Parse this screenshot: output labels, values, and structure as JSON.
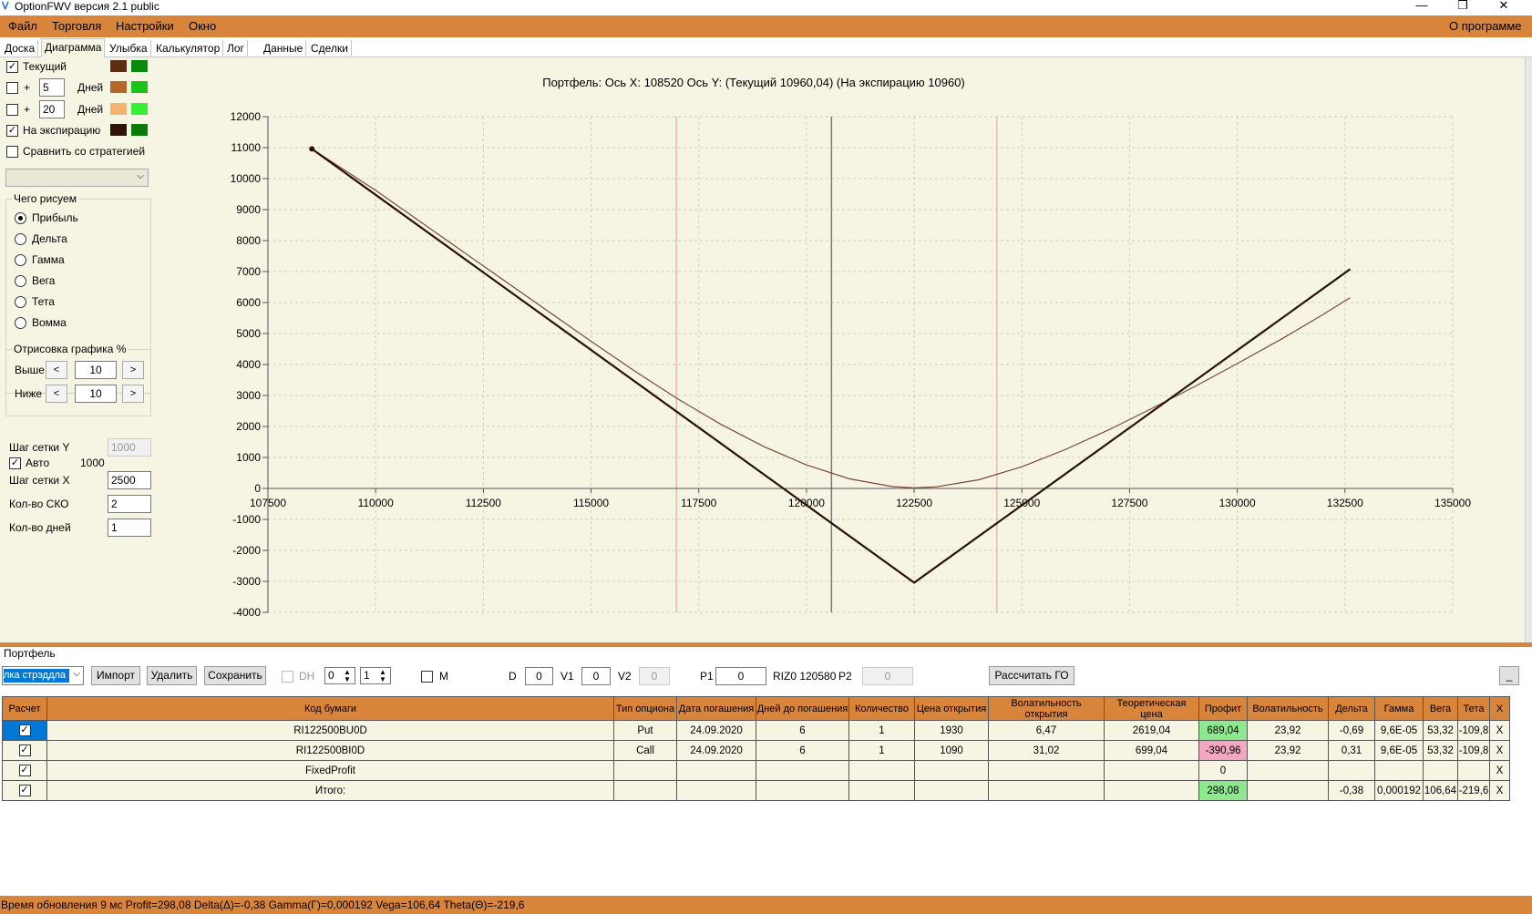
{
  "window": {
    "title": "OptionFWV версия 2.1 public"
  },
  "menu": {
    "file": "Файл",
    "trade": "Торговля",
    "settings": "Настройки",
    "window": "Окно",
    "about": "О программе"
  },
  "tabs": [
    "Доска",
    "Диаграмма",
    "Улыбка",
    "Калькулятор",
    "Лог",
    "Данные",
    "Сделки"
  ],
  "left": {
    "current": "Текущий",
    "plus": "+",
    "days": "Дней",
    "days1": "5",
    "days2": "20",
    "expiry": "На экспирацию",
    "compare": "Сравнить со стратегией",
    "what_draw": "Чего рисуем",
    "radios": [
      "Прибыль",
      "Дельта",
      "Гамма",
      "Вега",
      "Тета",
      "Вомма"
    ],
    "draw_pct": "Отрисовка графика %",
    "above": "Выше",
    "below": "Ниже",
    "above_val": "10",
    "below_val": "10",
    "lt": "<",
    "gt": ">",
    "grid_y": "Шаг сетки Y",
    "grid_y_val": "1000",
    "auto": "Авто",
    "auto_val": "1000",
    "grid_x": "Шаг сетки X",
    "grid_x_val": "2500",
    "sko": "Кол-во СКО",
    "sko_val": "2",
    "ndays": "Кол-во дней",
    "ndays_val": "1"
  },
  "colors": {
    "current_a": "#5c2e12",
    "current_b": "#0a8a0a",
    "d5_a": "#b8652a",
    "d5_b": "#18c418",
    "d20_a": "#f5b370",
    "d20_b": "#36f036",
    "exp_a": "#2e1606",
    "exp_b": "#0a7a0a",
    "curve_current": "#7a4a36",
    "curve_expiry": "#2a1208",
    "vline": "#7a7a7a",
    "vline_sd": "#e89a9a"
  },
  "chart_data": {
    "type": "line",
    "title": "Портфель: Ось X: 108520 Ось Y:  (Текущий 10960,04)  (На экспирацию 10960)",
    "xlim": [
      107500,
      135000
    ],
    "ylim": [
      -4000,
      12000
    ],
    "x_ticks": [
      107500,
      110000,
      112500,
      115000,
      117500,
      120000,
      122500,
      125000,
      127500,
      130000,
      132500,
      135000
    ],
    "y_ticks": [
      12000,
      11000,
      10000,
      9000,
      8000,
      7000,
      6000,
      5000,
      4000,
      3000,
      2000,
      1000,
      0,
      -1000,
      -2000,
      -3000,
      -4000
    ],
    "current_price": 120580,
    "sd_lines": [
      116980,
      124420
    ],
    "marker": [
      108520,
      10960
    ],
    "series": [
      {
        "key": "current",
        "points": [
          [
            108520,
            10960
          ],
          [
            110000,
            9620
          ],
          [
            112500,
            7180
          ],
          [
            115000,
            4750
          ],
          [
            116000,
            3800
          ],
          [
            117000,
            2900
          ],
          [
            118000,
            2080
          ],
          [
            119000,
            1360
          ],
          [
            120000,
            760
          ],
          [
            121000,
            310
          ],
          [
            122000,
            60
          ],
          [
            122500,
            20
          ],
          [
            123000,
            50
          ],
          [
            124000,
            280
          ],
          [
            125000,
            700
          ],
          [
            126000,
            1250
          ],
          [
            127000,
            1880
          ],
          [
            128000,
            2570
          ],
          [
            129000,
            3280
          ],
          [
            130000,
            4030
          ],
          [
            131000,
            4800
          ],
          [
            132000,
            5620
          ],
          [
            132620,
            6160
          ]
        ]
      },
      {
        "key": "expiry",
        "points": [
          [
            108520,
            10960
          ],
          [
            122500,
            -3040
          ],
          [
            132620,
            7080
          ]
        ]
      }
    ]
  },
  "portfolio": {
    "caption": "Портфель",
    "strategy": "лка стрэддла",
    "import": "Импорт",
    "delete": "Удалить",
    "save": "Сохранить",
    "dh": "DH",
    "spin1": "0",
    "spin2": "1",
    "m": "M",
    "d_label": "D",
    "d_val": "0",
    "v1_label": "V1",
    "v1_val": "0",
    "v2_label": "V2",
    "v2_val": "0",
    "p1_label": "P1",
    "p1_val": "0",
    "riz": "RIZ0 120580",
    "p2_label": "P2",
    "p2_val": "0",
    "calc_go": "Рассчитать ГО",
    "minimize": "_"
  },
  "table": {
    "headers": [
      "Расчет",
      "Код бумаги",
      "Тип опциона",
      "Дата погашения",
      "Дней до погашения",
      "Количество",
      "Цена открытия",
      "Волатильность открытия",
      "Теоретическая цена",
      "Профит",
      "Волатильность",
      "Дельта",
      "Гамма",
      "Вега",
      "Тета",
      "X"
    ],
    "rows": [
      [
        "",
        "RI122500BU0D",
        "Put",
        "24.09.2020",
        "6",
        "1",
        "1930",
        "6,47",
        "2619,04",
        "689,04",
        "23,92",
        "-0,69",
        "9,6E-05",
        "53,32",
        "-109,8",
        "X"
      ],
      [
        "",
        "RI122500BI0D",
        "Call",
        "24.09.2020",
        "6",
        "1",
        "1090",
        "31,02",
        "699,04",
        "-390,96",
        "23,92",
        "0,31",
        "9,6E-05",
        "53,32",
        "-109,8",
        "X"
      ],
      [
        "",
        "FixedProfit",
        "",
        "",
        "",
        "",
        "",
        "",
        "",
        "0",
        "",
        "",
        "",
        "",
        "",
        "X"
      ],
      [
        "",
        "Итого:",
        "",
        "",
        "",
        "",
        "",
        "",
        "",
        "298,08",
        "",
        "-0,38",
        "0,000192",
        "106,64",
        "-219,6",
        "X"
      ]
    ],
    "check": "✓"
  },
  "status": "Время обновления 9 мс  Profit=298,08 Delta(Δ)=-0,38 Gamma(Γ)=0,000192 Vega=106,64 Theta(Θ)=-219,6"
}
